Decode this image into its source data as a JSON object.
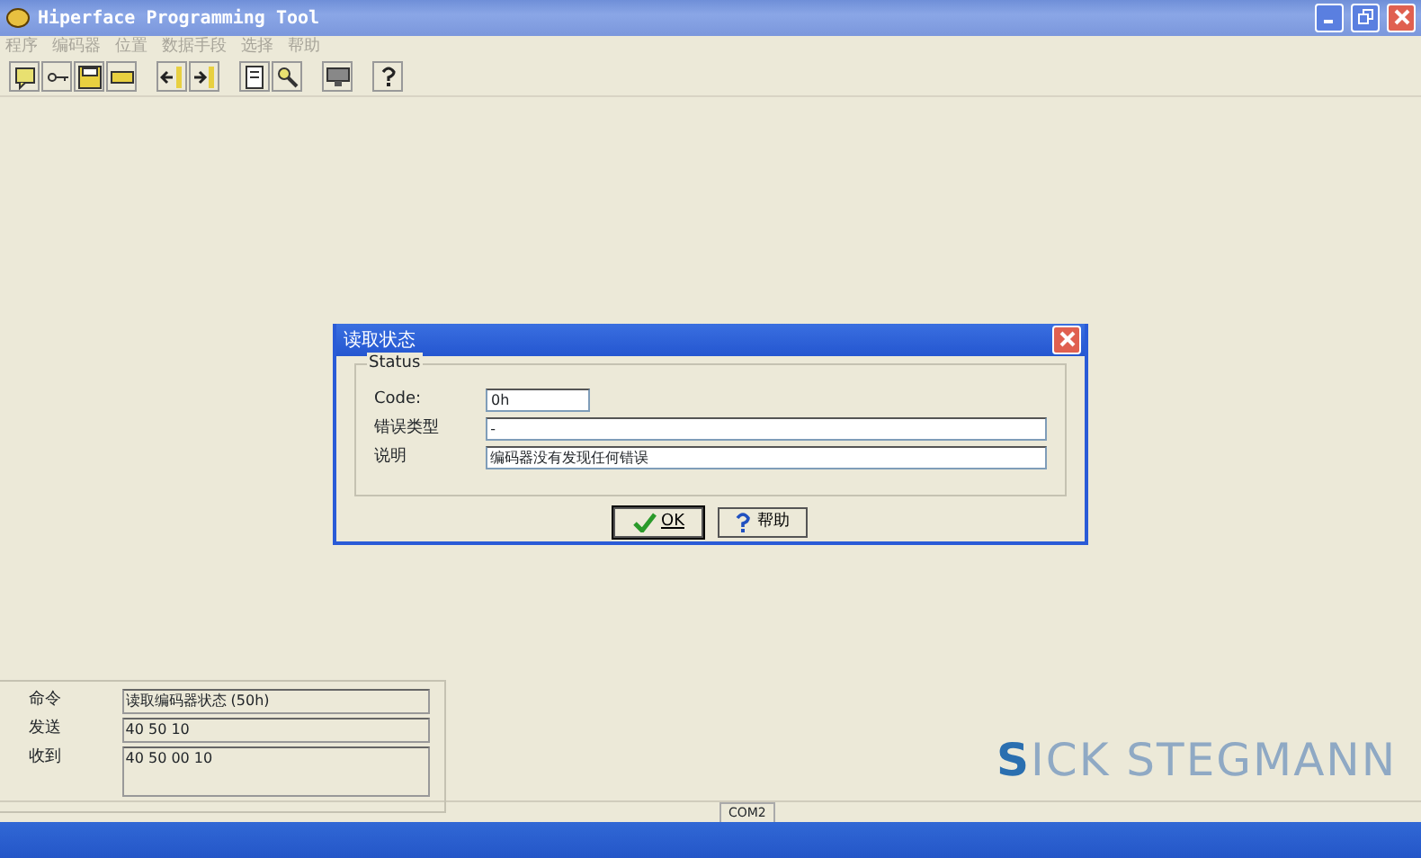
{
  "window": {
    "title": "Hiperface Programming Tool"
  },
  "menu": [
    {
      "label": "程序",
      "disabled": true
    },
    {
      "label": "编码器",
      "disabled": true
    },
    {
      "label": "位置",
      "disabled": true
    },
    {
      "label": "数据手段",
      "disabled": true
    },
    {
      "label": "选择",
      "disabled": true
    },
    {
      "label": "帮助",
      "disabled": true
    }
  ],
  "toolbar": [
    {
      "kind": "note"
    },
    {
      "kind": "key"
    },
    {
      "kind": "save"
    },
    {
      "kind": "chip"
    },
    {
      "kind": "sep"
    },
    {
      "kind": "left"
    },
    {
      "kind": "right"
    },
    {
      "kind": "sep"
    },
    {
      "kind": "doc"
    },
    {
      "kind": "search"
    },
    {
      "kind": "sep"
    },
    {
      "kind": "monitor"
    },
    {
      "kind": "sep"
    },
    {
      "kind": "help"
    }
  ],
  "dialog": {
    "title": "读取状态",
    "group": "Status",
    "fields": [
      {
        "label": "Code:",
        "value": "0h",
        "kind": "short"
      },
      {
        "label": "错误类型",
        "value": "-",
        "kind": "long"
      },
      {
        "label": "说明",
        "value": "编码器没有发现任何错误",
        "kind": "long"
      }
    ],
    "buttons": [
      {
        "label": "OK",
        "kind": "ok",
        "default": true
      },
      {
        "label": "帮助",
        "kind": "help",
        "default": false
      }
    ]
  },
  "command_panel": [
    {
      "label": "命令",
      "value": "读取编码器状态 (50h)"
    },
    {
      "label": "发送",
      "value": "40 50 10"
    },
    {
      "label": "收到",
      "value": "40 50 00 10"
    }
  ],
  "logo": {
    "first": "S",
    "rest": "ICK  STEGMANN"
  },
  "status_bar": {
    "port": "COM2"
  }
}
